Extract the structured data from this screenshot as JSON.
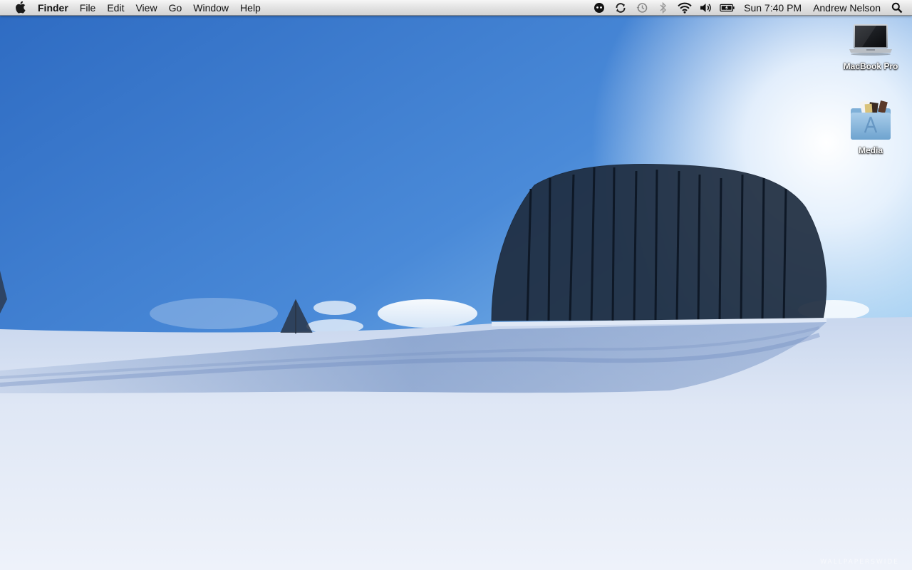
{
  "menubar": {
    "apple_icon": "apple-logo-icon",
    "app_name": "Finder",
    "menus": [
      "File",
      "Edit",
      "View",
      "Go",
      "Window",
      "Help"
    ],
    "status_icons": [
      "dropbox-icon",
      "sync-icon",
      "time-machine-icon",
      "bluetooth-icon",
      "wifi-icon",
      "volume-icon",
      "battery-icon"
    ],
    "clock": "Sun 7:40 PM",
    "user": "Andrew Nelson",
    "spotlight_icon": "spotlight-search-icon"
  },
  "desktop_icons": [
    {
      "label": "MacBook Pro",
      "icon": "laptop-icon"
    },
    {
      "label": "Media",
      "icon": "folder-icon"
    }
  ],
  "wallpaper": {
    "description_colors": {
      "sky_top": "#2f6fc4",
      "sky_bottom": "#9ccaf0",
      "snow": "#e8eef8",
      "shadow": "#6f8fc0"
    },
    "watermark": "WALLPAPERSWIDE"
  }
}
